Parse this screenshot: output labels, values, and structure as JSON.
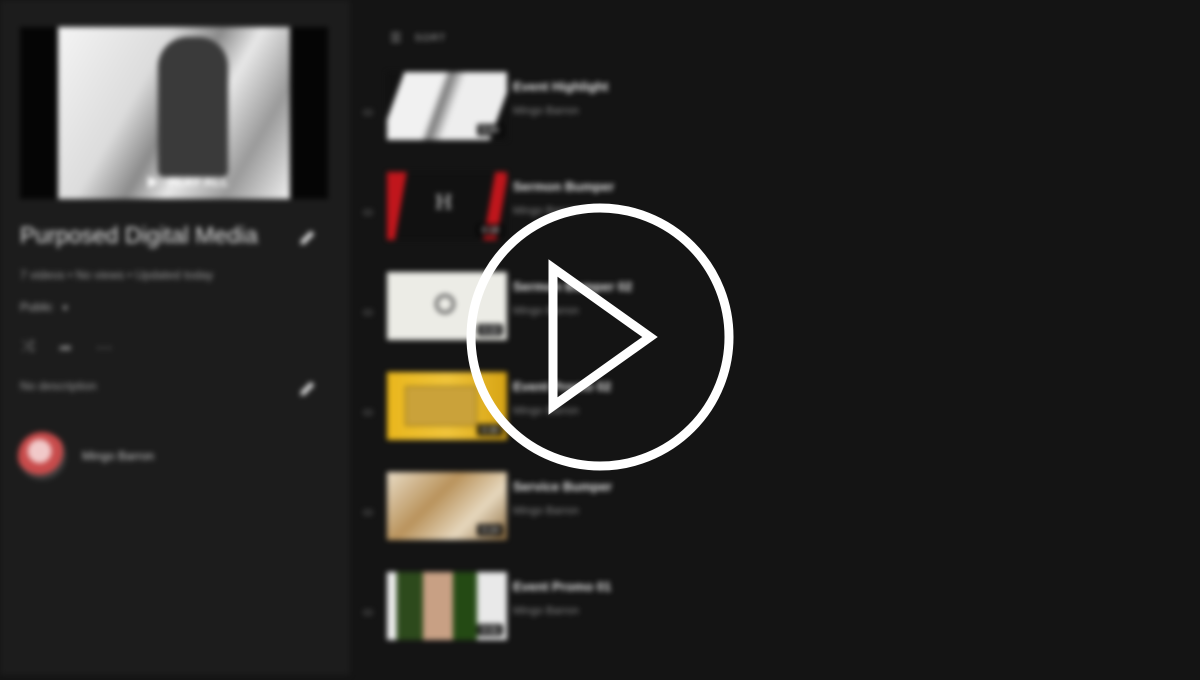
{
  "playlist": {
    "play_all_label": "PLAY ALL",
    "title": "Purposed Digital Media",
    "meta": "7 videos • No views • Updated today",
    "privacy": "Public",
    "description": "No description",
    "owner": "Mingo Barron"
  },
  "sort": {
    "label": "SORT"
  },
  "videos": [
    {
      "title": "Event Highlight",
      "owner": "Mingo Barron",
      "duration": "0:49"
    },
    {
      "title": "Sermon Bumper",
      "owner": "Mingo Barron",
      "duration": "0:18"
    },
    {
      "title": "Sermon Bumper 02",
      "owner": "Mingo Barron",
      "duration": "0:22"
    },
    {
      "title": "Event Promo 02",
      "owner": "Mingo Barron",
      "duration": "0:30"
    },
    {
      "title": "Service Bumper",
      "owner": "Mingo Barron",
      "duration": "0:24"
    },
    {
      "title": "Event Promo 01",
      "owner": "Mingo Barron",
      "duration": "0:31"
    }
  ],
  "icons": {
    "play": "play-circle-icon",
    "edit": "pencil-icon",
    "shuffle": "shuffle-icon",
    "share": "share-icon",
    "more": "more-icon",
    "sort": "sort-icon",
    "drag": "drag-handle-icon"
  },
  "colors": {
    "background": "#141414",
    "sidebar": "#1c1c1c",
    "overlay": "#ffffff"
  }
}
